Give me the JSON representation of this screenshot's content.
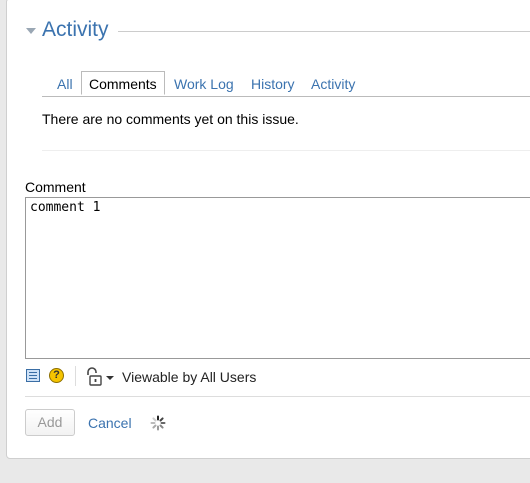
{
  "section": {
    "title": "Activity"
  },
  "tabs": [
    {
      "label": "All"
    },
    {
      "label": "Comments",
      "active": true
    },
    {
      "label": "Work Log"
    },
    {
      "label": "History"
    },
    {
      "label": "Activity"
    }
  ],
  "empty_message": "There are no comments yet on this issue.",
  "comment": {
    "label": "Comment",
    "value": "comment 1"
  },
  "toolbar": {
    "icons": [
      "wiki-markup-icon",
      "help-icon",
      "lock-icon",
      "chevron-down-icon"
    ],
    "visibility_label": "Viewable by All Users"
  },
  "actions": {
    "add_label": "Add",
    "cancel_label": "Cancel",
    "loading_icon": "spinner-icon"
  },
  "colors": {
    "link": "#3b73af",
    "disabled_text": "#999999",
    "background": "#e9e9e9"
  }
}
